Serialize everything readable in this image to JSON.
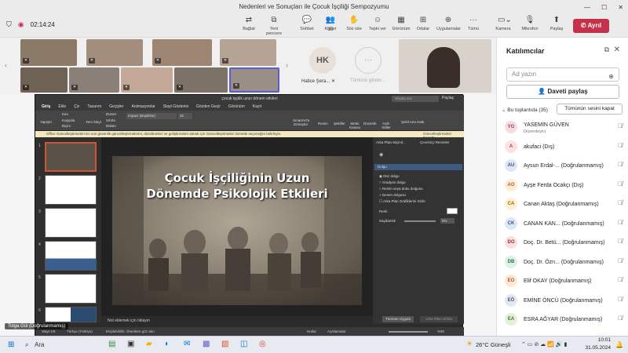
{
  "window": {
    "title": "Nedenleri ve Sonuçları ile Çocuk İşçiliği Sempozyumu",
    "timer": "02:14:24"
  },
  "toolbar": {
    "items": [
      {
        "label": "Bağlat"
      },
      {
        "label": "Yeni pencere"
      },
      {
        "label": "Sohbet"
      },
      {
        "label": "Kişiler",
        "count": "35"
      },
      {
        "label": "Söz iste"
      },
      {
        "label": "Tepki ver"
      },
      {
        "label": "Görünüm"
      },
      {
        "label": "Odalar"
      },
      {
        "label": "Uygulamalar"
      },
      {
        "label": "Tümü"
      },
      {
        "label": "Kamera"
      },
      {
        "label": "Mikrofon"
      },
      {
        "label": "Paylaş"
      }
    ],
    "leave_label": "Ayrıl"
  },
  "video": {
    "hk_initials": "HK",
    "hk_name": "Hatice Şera...",
    "more_label": "Tümünü göster...",
    "presenter_label": "Tolga Gül (Doğrulanmamış)"
  },
  "panel": {
    "title": "Katılımcılar",
    "search_placeholder": "Ad yazın",
    "invite_label": "Daveti paylaş",
    "meeting_label": "Bu toplantıda (35)",
    "mute_all_label": "Tümünün sesini kapat",
    "participants": [
      {
        "initials": "YG",
        "name": "YASEMİN GÜVEN",
        "sub": "Düzenleyici",
        "bg": "#f6dde2",
        "fg": "#a33a52"
      },
      {
        "initials": "A",
        "name": "akufaci (Dış)",
        "sub": "",
        "bg": "#fde3e3",
        "fg": "#c4314b"
      },
      {
        "initials": "AU",
        "name": "Aysun Erdal-... (Doğrulanmamış)",
        "sub": "",
        "bg": "#e1e6f5",
        "fg": "#3b4a8a"
      },
      {
        "initials": "AO",
        "name": "Ayşe Ferda Ocakçı (Dış)",
        "sub": "",
        "bg": "#fdecd8",
        "fg": "#b35c14"
      },
      {
        "initials": "CA",
        "name": "Canan Aktaş (Doğrulanmamış)",
        "sub": "",
        "bg": "#fdf0d5",
        "fg": "#9a6b00"
      },
      {
        "initials": "CK",
        "name": "CANAN KAN... (Doğrulanmamış)",
        "sub": "",
        "bg": "#dde7f5",
        "fg": "#2b579a"
      },
      {
        "initials": "DO",
        "name": "Doç. Dr. Betü... (Doğrulanmamış)",
        "sub": "",
        "bg": "#f9e0e0",
        "fg": "#a4262c"
      },
      {
        "initials": "DB",
        "name": "Doç. Dr. Özn... (Doğrulanmamış)",
        "sub": "",
        "bg": "#dff0e6",
        "fg": "#1f7a4a"
      },
      {
        "initials": "EO",
        "name": "Elif OKAY (Doğrulanmamış)",
        "sub": "",
        "bg": "#fde7d6",
        "fg": "#b3541e"
      },
      {
        "initials": "EÖ",
        "name": "EMİNE ÖNCÜ (Doğrulanmamış)",
        "sub": "",
        "bg": "#e4e8f2",
        "fg": "#4a5577"
      },
      {
        "initials": "EA",
        "name": "ESRA AĞYAR (Doğrulanmamış)",
        "sub": "",
        "bg": "#e3f0da",
        "fg": "#3c7a1e"
      }
    ]
  },
  "ppt": {
    "doc_title": "çocuk işçilik uzun dönem etkileri",
    "search_placeholder": "Slaytta ara",
    "share_label": "Paylaş",
    "tabs": [
      "Giriş",
      "Ekle",
      "Çiz",
      "Tasarım",
      "Geçişler",
      "Animasyonlar",
      "Slayt Gösterisi",
      "Gözden Geçir",
      "Görünüm",
      "Kayıt"
    ],
    "ribbon": [
      "Yapıştır",
      "Kes",
      "Kopyala",
      "Biçim",
      "Yeni Slayt",
      "Düzen",
      "Sıfırla",
      "Bölüm",
      "Resim",
      "Şekiller",
      "Metin Kutusu",
      "Düzenle",
      "Hızlı Stiller",
      "Şekil Ana Hattı",
      "SmartArt'a Dönüştür"
    ],
    "font_name": "Impact (Başlıklar)",
    "font_size": "32",
    "info_text": "Office Güncelleştirmeleri  En son güvenlik güncelleştirmelerini, düzeltmeleri ve geliştirmeleri almak için Güncelleştirmeleri Denetle seçeneğini belirleyin.",
    "info_button": "Güncelleştirmeleri Denetle",
    "slide_title_1": "Çocuk İşçiliğinin Uzun",
    "slide_title_2": "Dönemde Psikolojik Etkileri",
    "notes_placeholder": "Not eklemek için tıklayın",
    "thumb_numbers": [
      "1",
      "2",
      "3",
      "4",
      "5",
      "6"
    ],
    "format_pane": {
      "tabs": [
        "Arka Planı Biçiml...",
        "Çevrimiçi Resimler"
      ],
      "section": "Dolgu",
      "options": [
        "Düz dolgu",
        "Gradyan dolgu",
        "Resim veya doku dolgusu",
        "Desen dolgusu",
        "Arka Plan Grafiklerini Gizle"
      ],
      "color_label": "Renk",
      "transparency_label": "Saydamlık",
      "transparency_value": "0%",
      "apply_all": "Tümüne Uygula",
      "reset": "Arka Planı Sıfırla"
    },
    "status": {
      "slide": "Slayt 1/6",
      "lang": "Türkçe (Türkiye)",
      "access": "Erişilebilirlik: Önerilere göz atın",
      "notes": "Notlar",
      "comments": "Açıklamalar",
      "zoom": "%90"
    }
  },
  "taskbar": {
    "search": "Ara",
    "weather": "26°C Güneşli",
    "time": "10:01",
    "date": "31.05.2024"
  }
}
